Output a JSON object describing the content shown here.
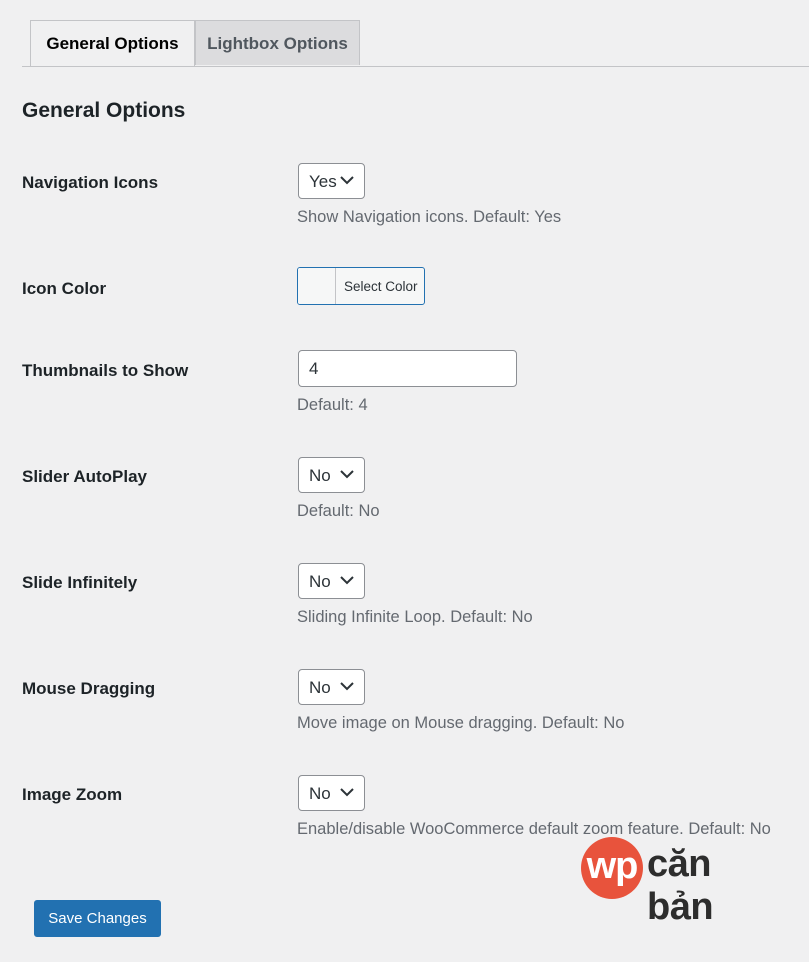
{
  "tabs": [
    {
      "label": "General Options",
      "active": true
    },
    {
      "label": "Lightbox Options",
      "active": false
    }
  ],
  "section_title": "General Options",
  "rows": {
    "navigation_icons": {
      "label": "Navigation Icons",
      "value": "Yes",
      "description": "Show Navigation icons. Default: Yes"
    },
    "icon_color": {
      "label": "Icon Color",
      "button_label": "Select Color"
    },
    "thumbnails": {
      "label": "Thumbnails to Show",
      "value": "4",
      "description": "Default: 4"
    },
    "slider_autoplay": {
      "label": "Slider AutoPlay",
      "value": "No",
      "description": "Default: No"
    },
    "slide_infinitely": {
      "label": "Slide Infinitely",
      "value": "No",
      "description": "Sliding Infinite Loop. Default: No"
    },
    "mouse_dragging": {
      "label": "Mouse Dragging",
      "value": "No",
      "description": "Move image on Mouse dragging. Default: No"
    },
    "image_zoom": {
      "label": "Image Zoom",
      "value": "No",
      "description": "Enable/disable WooCommerce default zoom feature. Default: No"
    }
  },
  "save_button": "Save Changes",
  "watermark": {
    "mark": "wp",
    "text": "căn bản"
  },
  "colors": {
    "accent": "#2271b1",
    "logo": "#e8533c"
  }
}
